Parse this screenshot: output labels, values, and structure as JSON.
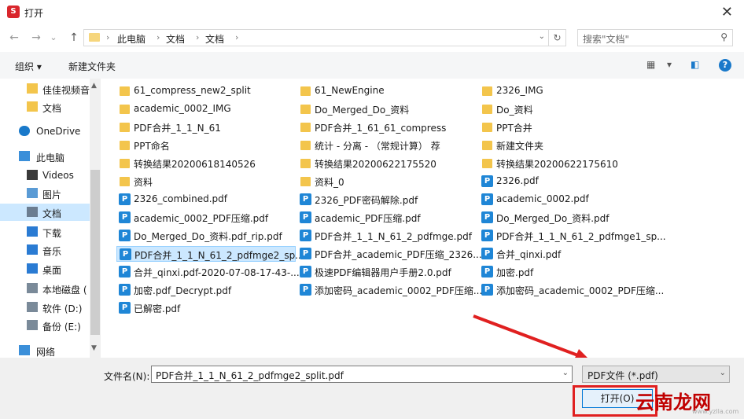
{
  "window": {
    "title": "打开",
    "close_glyph": "✕"
  },
  "nav": {
    "back": "←",
    "forward": "→",
    "recent": "⌄",
    "up": "↑"
  },
  "address": {
    "crumbs": [
      "此电脑",
      "文档",
      "文档"
    ],
    "sep": "›",
    "dropdown": "⌄",
    "refresh": "↻"
  },
  "search": {
    "placeholder": "搜索\"文档\"",
    "icon": "⚲"
  },
  "toolbar": {
    "organize": "组织 ▾",
    "new_folder": "新建文件夹",
    "view": "▦",
    "view_dd": "▾",
    "pane": "◧",
    "help": "?"
  },
  "sidebar": {
    "items": [
      {
        "label": "佳佳视频音",
        "icon": "folder-icon"
      },
      {
        "label": "文档",
        "icon": "folder-icon"
      },
      {
        "label": "OneDrive",
        "icon": "cloud-icon"
      },
      {
        "label": "此电脑",
        "icon": "computer-icon"
      },
      {
        "label": "Videos",
        "icon": "video-icon"
      },
      {
        "label": "图片",
        "icon": "picture-icon"
      },
      {
        "label": "文档",
        "icon": "document-icon",
        "selected": true
      },
      {
        "label": "下载",
        "icon": "download-icon"
      },
      {
        "label": "音乐",
        "icon": "music-icon"
      },
      {
        "label": "桌面",
        "icon": "desktop-icon"
      },
      {
        "label": "本地磁盘 (",
        "icon": "drive-icon"
      },
      {
        "label": "软件 (D:)",
        "icon": "drive-icon"
      },
      {
        "label": "备份 (E:)",
        "icon": "drive-icon"
      },
      {
        "label": "网络",
        "icon": "network-icon"
      }
    ]
  },
  "files": {
    "col1": [
      {
        "name": "61_compress_new2_split",
        "type": "folder"
      },
      {
        "name": "academic_0002_IMG",
        "type": "folder"
      },
      {
        "name": "PDF合并_1_1_N_61",
        "type": "folder"
      },
      {
        "name": "PPT命名",
        "type": "folder"
      },
      {
        "name": "转换结果20200618140526",
        "type": "folder"
      },
      {
        "name": "资料",
        "type": "folder"
      },
      {
        "name": "2326_combined.pdf",
        "type": "pdf"
      },
      {
        "name": "academic_0002_PDF压缩.pdf",
        "type": "pdf"
      },
      {
        "name": "Do_Merged_Do_资料.pdf_rip.pdf",
        "type": "pdf"
      },
      {
        "name": "PDF合并_1_1_N_61_2_pdfmge2_sp...",
        "type": "pdf",
        "selected": true
      },
      {
        "name": "合并_qinxi.pdf-2020-07-08-17-43-...",
        "type": "pdf"
      },
      {
        "name": "加密.pdf_Decrypt.pdf",
        "type": "pdf"
      },
      {
        "name": "已解密.pdf",
        "type": "pdf"
      }
    ],
    "col2": [
      {
        "name": "61_NewEngine",
        "type": "folder"
      },
      {
        "name": "Do_Merged_Do_资料",
        "type": "folder"
      },
      {
        "name": "PDF合并_1_61_61_compress",
        "type": "folder"
      },
      {
        "name": "统计 - 分离 - （常规计算） 荐",
        "type": "folder"
      },
      {
        "name": "转换结果20200622175520",
        "type": "folder"
      },
      {
        "name": "资料_0",
        "type": "folder"
      },
      {
        "name": "2326_PDF密码解除.pdf",
        "type": "pdf"
      },
      {
        "name": "academic_PDF压缩.pdf",
        "type": "pdf"
      },
      {
        "name": "PDF合并_1_1_N_61_2_pdfmge.pdf",
        "type": "pdf"
      },
      {
        "name": "PDF合并_academic_PDF压缩_2326....",
        "type": "pdf"
      },
      {
        "name": "极速PDF编辑器用户手册2.0.pdf",
        "type": "pdf"
      },
      {
        "name": "添加密码_academic_0002_PDF压缩...",
        "type": "pdf"
      }
    ],
    "col3": [
      {
        "name": "2326_IMG",
        "type": "folder"
      },
      {
        "name": "Do_资料",
        "type": "folder"
      },
      {
        "name": "PPT合并",
        "type": "folder"
      },
      {
        "name": "新建文件夹",
        "type": "folder"
      },
      {
        "name": "转换结果20200622175610",
        "type": "folder"
      },
      {
        "name": "2326.pdf",
        "type": "pdf"
      },
      {
        "name": "academic_0002.pdf",
        "type": "pdf"
      },
      {
        "name": "Do_Merged_Do_资料.pdf",
        "type": "pdf"
      },
      {
        "name": "PDF合并_1_1_N_61_2_pdfmge1_sp...",
        "type": "pdf"
      },
      {
        "name": "合并_qinxi.pdf",
        "type": "pdf"
      },
      {
        "name": "加密.pdf",
        "type": "pdf"
      },
      {
        "name": "添加密码_academic_0002_PDF压缩...",
        "type": "pdf"
      }
    ],
    "pdf_glyph": "P"
  },
  "footer": {
    "filename_label": "文件名(N):",
    "filename_value": "PDF合并_1_1_N_61_2_pdfmge2_split.pdf",
    "filetype_value": "PDF文件 (*.pdf)",
    "open_label": "打开(O)",
    "dropdown": "⌄"
  },
  "watermark": {
    "text": "云南龙网",
    "sub": "www.yzlla.com"
  },
  "colors": {
    "accent": "#0078d7",
    "selection": "#cce8ff",
    "folder": "#f3c54c",
    "pdf": "#1f86d6",
    "annotation": "#e02020"
  }
}
